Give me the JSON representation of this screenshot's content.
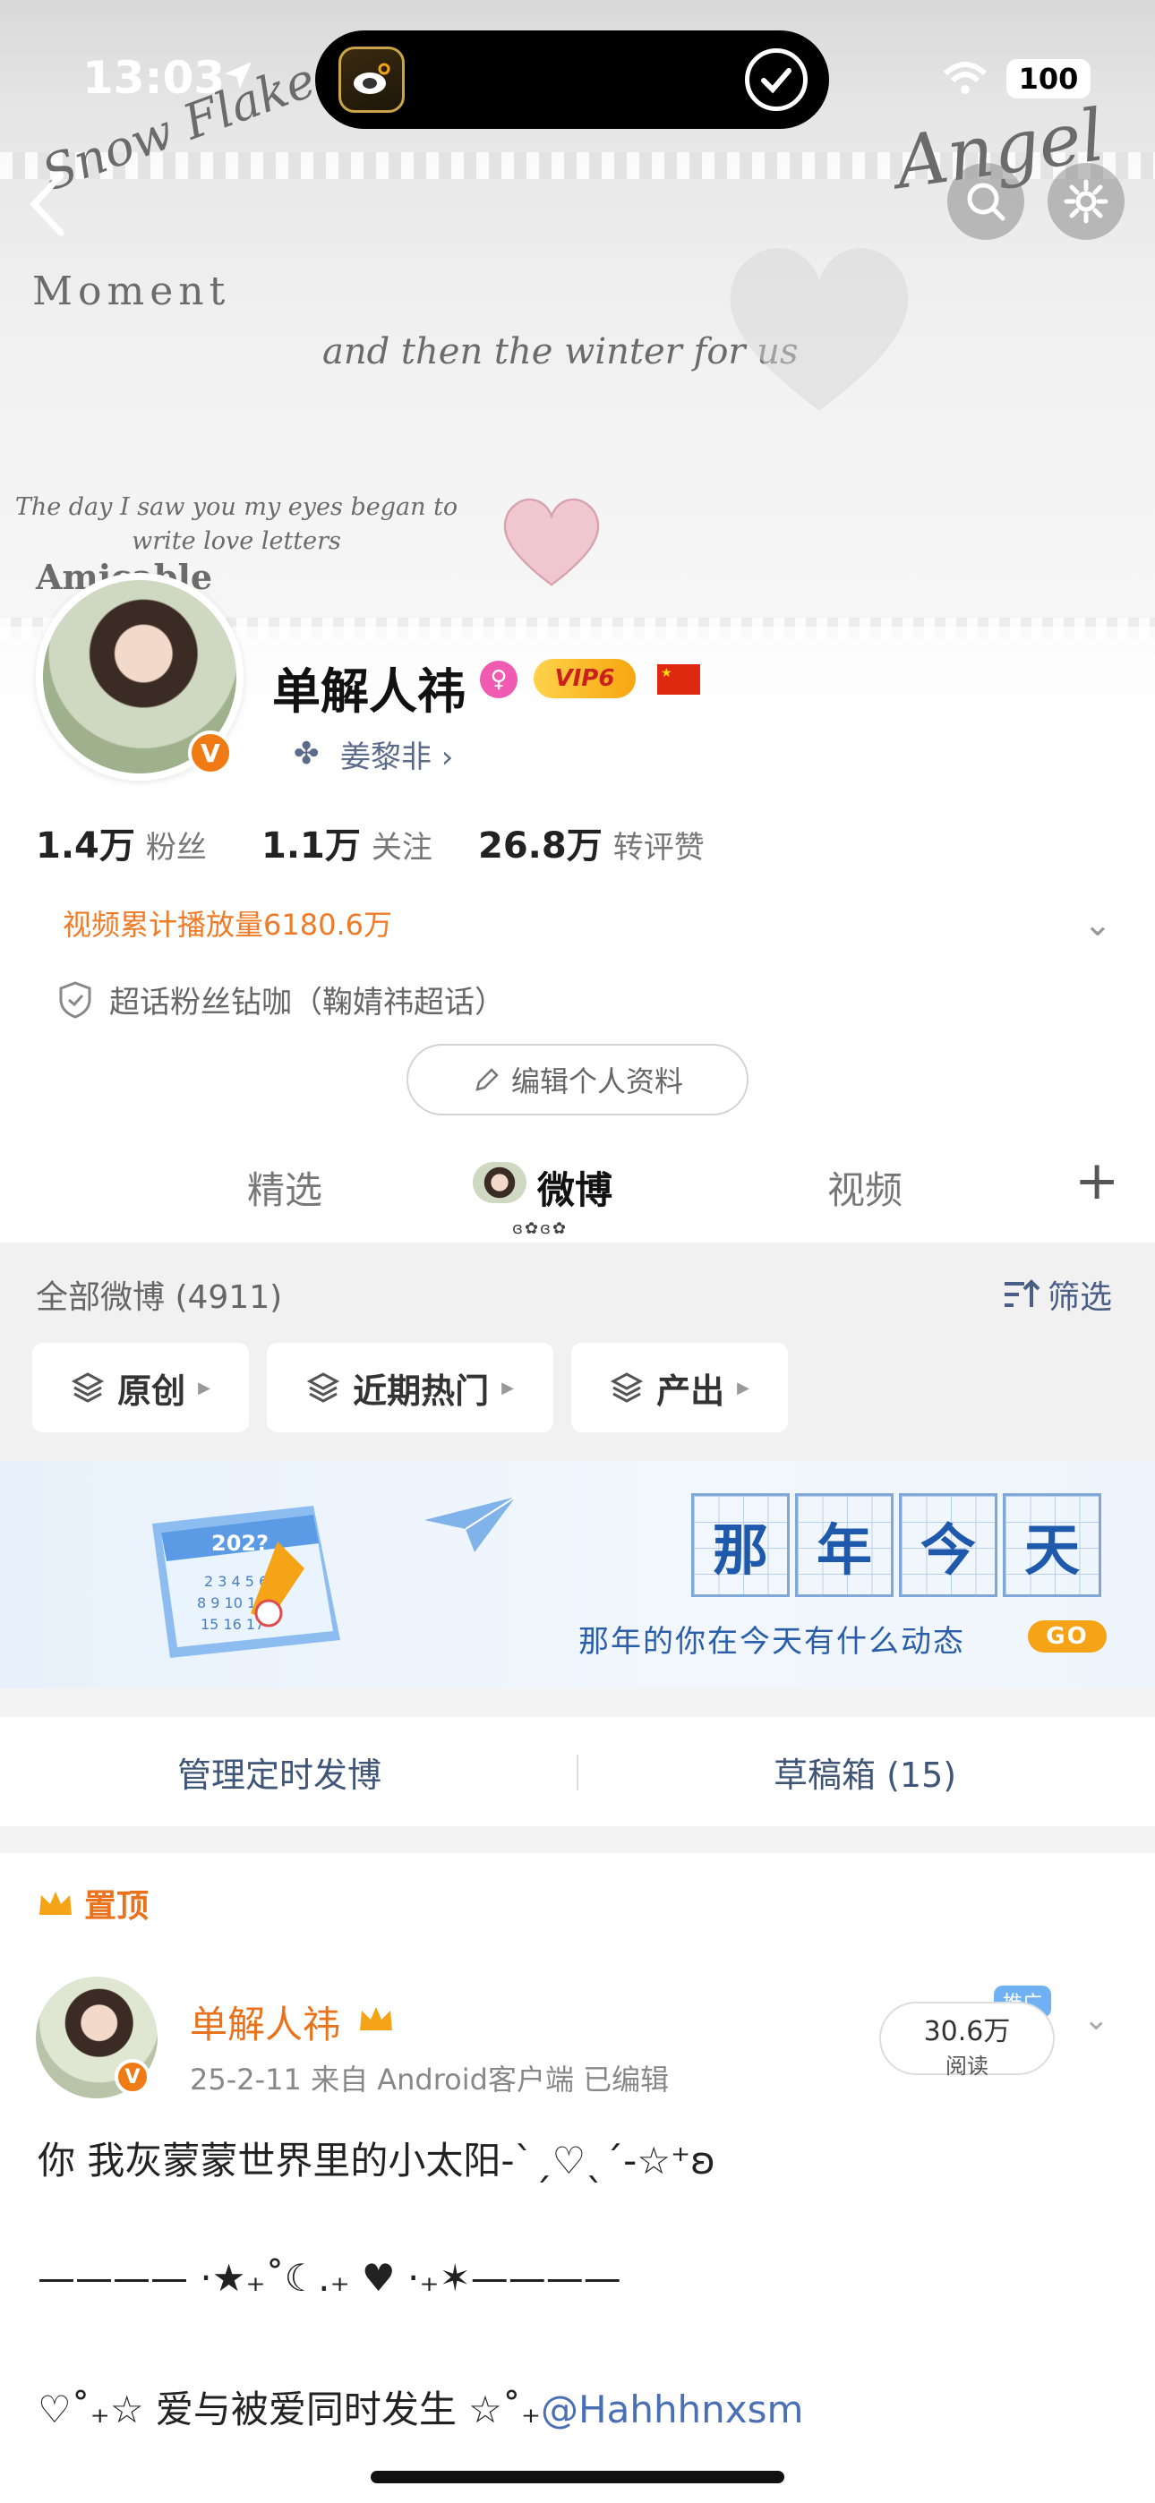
{
  "status_bar": {
    "time": "13:03",
    "battery": "100"
  },
  "banner": {
    "script_1": "Snow Flake",
    "script_2": "Moment",
    "script_3": "Angel",
    "script_4": "and then the winter for us",
    "script_5": "The day I saw you my eyes began to write love letters",
    "script_6": "Amicable"
  },
  "profile": {
    "name": "单解人祎",
    "vip_level": "VIP6",
    "sub_link": "姜黎非 ›",
    "stats": [
      {
        "value": "1.4万",
        "label": "粉丝"
      },
      {
        "value": "1.1万",
        "label": "关注"
      },
      {
        "value": "26.8万",
        "label": "转评赞"
      }
    ],
    "video_plays": "视频累计播放量6180.6万",
    "super_fans": "超话粉丝钻咖（鞠婧祎超话）",
    "edit_button": "编辑个人资料"
  },
  "tabs": [
    {
      "label": "精选",
      "active": false
    },
    {
      "label": "微博",
      "active": true
    },
    {
      "label": "视频",
      "active": false
    }
  ],
  "filters": {
    "all_posts": "全部微博 (4911)",
    "filter_label": "筛选",
    "chips": [
      "原创",
      "近期热门",
      "产出"
    ]
  },
  "memory": {
    "chars": [
      "那",
      "年",
      "今",
      "天"
    ],
    "calendar_year": "202?",
    "subtitle": "那年的你在今天有什么动态",
    "go": "GO"
  },
  "manage": {
    "scheduled": "管理定时发博",
    "drafts": "草稿箱 (15)"
  },
  "post": {
    "pinned": "置顶",
    "author": "单解人祎",
    "meta": "25-2-11  来自 Android客户端  已编辑",
    "reads_num": "30.6万",
    "reads_label": "阅读",
    "promo": "推广",
    "line1": "你 我灰蒙蒙世界里的小太阳-ˋˏ♡ˎˊ-☆⁺ʚ",
    "line2": "———— ·★₊˚☾.₊ ♥ ·₊✶————",
    "line3_text": "♡˚₊☆ 爱与被爱同时发生    ☆˚₊",
    "line3_mention": "@Hahhhnxsm"
  },
  "colors": {
    "accent": "#e8731c",
    "link": "#4a6fb5",
    "go": "#f5a418"
  }
}
